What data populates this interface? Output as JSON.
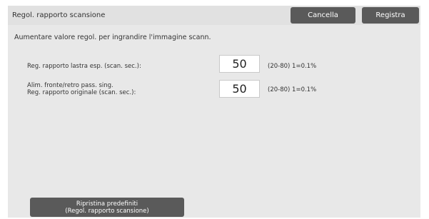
{
  "header": {
    "title": "Regol. rapporto scansione",
    "cancel_label": "Cancella",
    "save_label": "Registra"
  },
  "description": "Aumentare valore regol. per ingrandire l'immagine scann.",
  "settings": [
    {
      "label_lines": [
        "Reg. rapporto lastra esp. (scan. sec.):"
      ],
      "value": "50",
      "range": "(20-80) 1=0.1%"
    },
    {
      "label_lines": [
        "Alim. fronte/retro pass. sing.",
        "Reg. rapporto originale (scan. sec.):"
      ],
      "value": "50",
      "range": "(20-80) 1=0.1%"
    }
  ],
  "reset_button": {
    "line1": "Ripristina predefiniti",
    "line2": "(Regol. rapporto scansione)"
  }
}
